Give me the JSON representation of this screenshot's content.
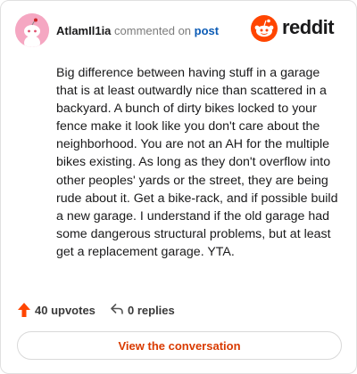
{
  "colors": {
    "brand": "#ff4500",
    "link": "#0b5bb5",
    "cta_text": "#d93a00",
    "avatar_bg": "#f5a7c2"
  },
  "header": {
    "username": "AtlamIl1ia",
    "action_text": "commented on",
    "target_link": "post",
    "logo_text": "reddit",
    "avatar_icon": "snoo-avatar-icon",
    "logo_icon": "reddit-logo-icon"
  },
  "comment": {
    "text": "Big difference between having stuff in a garage that is at least outwardly nice than scattered in a backyard. A bunch of dirty bikes locked to your fence make it look like you don't care about the neighborhood. You are not an AH for the multiple bikes existing. As long as they don't overflow into other peoples' yards or the street, they are being rude about it. Get a bike-rack, and if possible build a new garage. I understand if the old garage had some dangerous structural problems, but at least get a replacement garage. YTA."
  },
  "footer": {
    "upvotes": "40 upvotes",
    "upvote_icon": "upvote-arrow-icon",
    "replies": "0 replies",
    "reply_icon": "reply-icon",
    "cta_label": "View the conversation"
  }
}
